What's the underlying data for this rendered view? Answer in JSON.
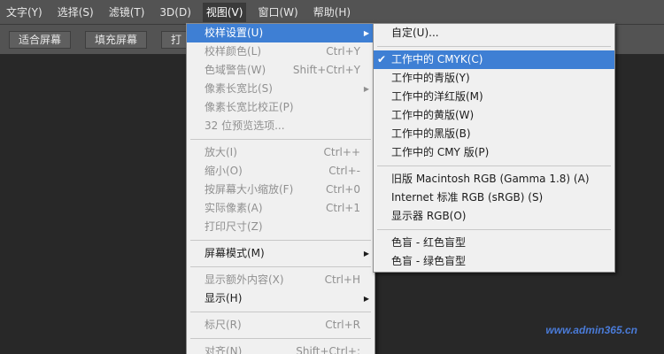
{
  "menubar": {
    "items": [
      {
        "label": "文字(Y)",
        "active": false
      },
      {
        "label": "选择(S)",
        "active": false
      },
      {
        "label": "滤镜(T)",
        "active": false
      },
      {
        "label": "3D(D)",
        "active": false
      },
      {
        "label": "视图(V)",
        "active": true
      },
      {
        "label": "窗口(W)",
        "active": false
      },
      {
        "label": "帮助(H)",
        "active": false
      }
    ]
  },
  "optionsbar": {
    "buttons": [
      "适合屏幕",
      "填充屏幕",
      "打"
    ]
  },
  "view_menu": {
    "items": [
      {
        "label": "校样设置(U)",
        "shortcut": "",
        "submenu": true,
        "disabled": false,
        "highlighted": true
      },
      {
        "label": "校样颜色(L)",
        "shortcut": "Ctrl+Y",
        "submenu": false,
        "disabled": true
      },
      {
        "label": "色域警告(W)",
        "shortcut": "Shift+Ctrl+Y",
        "submenu": false,
        "disabled": true
      },
      {
        "label": "像素长宽比(S)",
        "shortcut": "",
        "submenu": true,
        "disabled": true
      },
      {
        "label": "像素长宽比校正(P)",
        "shortcut": "",
        "submenu": false,
        "disabled": true
      },
      {
        "label": "32 位预览选项...",
        "shortcut": "",
        "submenu": false,
        "disabled": true
      },
      {
        "separator": true
      },
      {
        "label": "放大(I)",
        "shortcut": "Ctrl++",
        "submenu": false,
        "disabled": true
      },
      {
        "label": "缩小(O)",
        "shortcut": "Ctrl+-",
        "submenu": false,
        "disabled": true
      },
      {
        "label": "按屏幕大小缩放(F)",
        "shortcut": "Ctrl+0",
        "submenu": false,
        "disabled": true
      },
      {
        "label": "实际像素(A)",
        "shortcut": "Ctrl+1",
        "submenu": false,
        "disabled": true
      },
      {
        "label": "打印尺寸(Z)",
        "shortcut": "",
        "submenu": false,
        "disabled": true
      },
      {
        "separator": true
      },
      {
        "label": "屏幕模式(M)",
        "shortcut": "",
        "submenu": true,
        "disabled": false
      },
      {
        "separator": true
      },
      {
        "label": "显示额外内容(X)",
        "shortcut": "Ctrl+H",
        "submenu": false,
        "disabled": true
      },
      {
        "label": "显示(H)",
        "shortcut": "",
        "submenu": true,
        "disabled": false
      },
      {
        "separator": true
      },
      {
        "label": "标尺(R)",
        "shortcut": "Ctrl+R",
        "submenu": false,
        "disabled": true
      },
      {
        "separator": true
      },
      {
        "label": "对齐(N)",
        "shortcut": "Shift+Ctrl+;",
        "submenu": false,
        "disabled": true
      }
    ]
  },
  "proof_submenu": {
    "items": [
      {
        "label": "自定(U)...",
        "checked": false,
        "highlighted": false
      },
      {
        "separator": true
      },
      {
        "label": "工作中的 CMYK(C)",
        "checked": true,
        "highlighted": true
      },
      {
        "label": "工作中的青版(Y)",
        "checked": false,
        "highlighted": false
      },
      {
        "label": "工作中的洋红版(M)",
        "checked": false,
        "highlighted": false
      },
      {
        "label": "工作中的黄版(W)",
        "checked": false,
        "highlighted": false
      },
      {
        "label": "工作中的黑版(B)",
        "checked": false,
        "highlighted": false
      },
      {
        "label": "工作中的 CMY 版(P)",
        "checked": false,
        "highlighted": false
      },
      {
        "separator": true
      },
      {
        "label": "旧版 Macintosh RGB (Gamma 1.8) (A)",
        "checked": false,
        "highlighted": false
      },
      {
        "label": "Internet 标准 RGB (sRGB) (S)",
        "checked": false,
        "highlighted": false
      },
      {
        "label": "显示器 RGB(O)",
        "checked": false,
        "highlighted": false
      },
      {
        "separator": true
      },
      {
        "label": "色盲 - 红色盲型",
        "checked": false,
        "highlighted": false
      },
      {
        "label": "色盲 - 绿色盲型",
        "checked": false,
        "highlighted": false
      }
    ]
  },
  "watermark": {
    "text": "www.admin365.cn"
  },
  "icons": {
    "submenu_arrow": "triangle-right-icon",
    "check": "checkmark-icon"
  }
}
